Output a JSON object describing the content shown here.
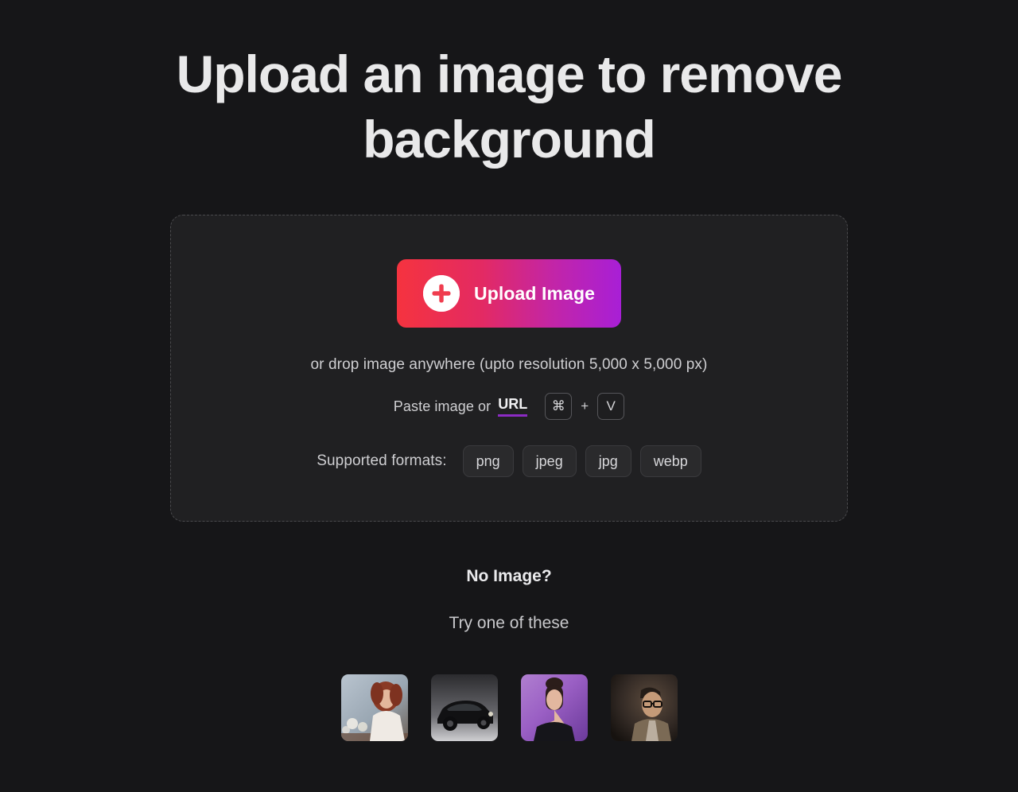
{
  "page": {
    "title": "Upload an image to remove background",
    "background_color": "#161618"
  },
  "dropzone": {
    "upload_button": {
      "label": "Upload Image",
      "icon": "plus-circle-icon",
      "gradient_start": "#f5333f",
      "gradient_end": "#a81fd6"
    },
    "drop_hint": "or drop image anywhere (upto resolution 5,000 x 5,000 px)",
    "paste": {
      "text": "Paste image or",
      "url_label": "URL",
      "url_underline_color": "#8b2bc4",
      "key_modifier": "⌘",
      "key_separator": "+",
      "key_letter": "V"
    },
    "formats": {
      "label": "Supported formats:",
      "items": [
        "png",
        "jpeg",
        "jpg",
        "webp"
      ]
    }
  },
  "no_image": {
    "title": "No Image?",
    "subtitle": "Try one of these",
    "samples": [
      {
        "name": "sample-woman-red-hair-bokeh",
        "alt": "Woman with red hair and bokeh lights"
      },
      {
        "name": "sample-black-classic-car",
        "alt": "Black classic car on gray backdrop"
      },
      {
        "name": "sample-woman-updo-purple",
        "alt": "Woman with updo hair on purple background"
      },
      {
        "name": "sample-man-glasses-dark",
        "alt": "Man with glasses in dark smoky scene"
      }
    ]
  }
}
